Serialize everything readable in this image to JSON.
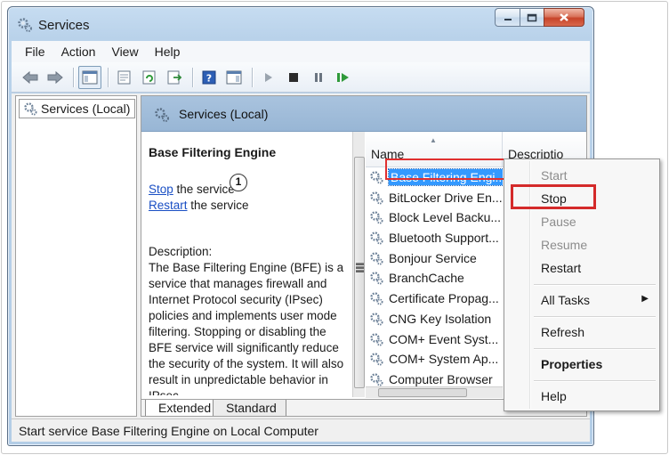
{
  "window": {
    "title": "Services"
  },
  "menubar": [
    "File",
    "Action",
    "View",
    "Help"
  ],
  "tree": {
    "root_label": "Services (Local)"
  },
  "pane_header": {
    "title": "Services (Local)"
  },
  "details": {
    "service_name": "Base Filtering Engine",
    "stop_link": "Stop",
    "stop_suffix": " the service",
    "restart_link": "Restart",
    "restart_suffix": " the service",
    "description_label": "Description:",
    "description_text": "The Base Filtering Engine (BFE) is a service that manages firewall and Internet Protocol security (IPsec) policies and implements user mode filtering. Stopping or disabling the BFE service will significantly reduce the security of the system. It will also result in unpredictable behavior in IPsec"
  },
  "list": {
    "columns": [
      "Name",
      "Descriptio"
    ],
    "rows": [
      "Base Filtering Engi...",
      "BitLocker Drive En...",
      "Block Level Backu...",
      "Bluetooth Support...",
      "Bonjour Service",
      "BranchCache",
      "Certificate Propag...",
      "CNG Key Isolation",
      "COM+ Event Syst...",
      "COM+ System Ap...",
      "Computer Browser"
    ],
    "selected_index": 0
  },
  "badge": "1",
  "tabs": [
    "Extended",
    "Standard"
  ],
  "status_text": "Start service Base Filtering Engine on Local Computer",
  "context_menu": {
    "start": "Start",
    "stop": "Stop",
    "pause": "Pause",
    "resume": "Resume",
    "restart": "Restart",
    "all_tasks": "All Tasks",
    "refresh": "Refresh",
    "properties": "Properties",
    "help": "Help"
  },
  "colors": {
    "highlight": "#d42a2a",
    "selection": "#3399ff",
    "link": "#1a4fc4"
  }
}
